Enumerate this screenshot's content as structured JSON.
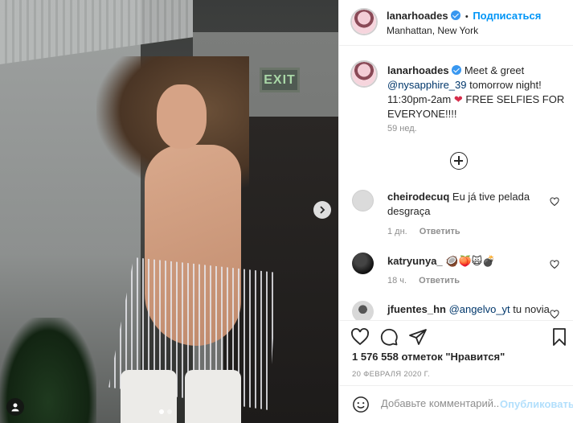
{
  "post": {
    "author": "lanarhoades",
    "follow_label": "Подписаться",
    "separator": "•",
    "location": "Manhattan, New York",
    "exit_sign_text": "EXIT"
  },
  "caption": {
    "author": "lanarhoades",
    "text_before": "Meet & greet",
    "mention": "@nysapphire_39",
    "text_after": "tomorrow night! 11:30pm-2am",
    "text_end": "FREE SELFIES FOR EVERYONE!!!!",
    "time": "59 нед."
  },
  "comments": [
    {
      "user": "cheirodecuq",
      "text": "Eu já tive pelada desgraça",
      "time": "1 дн.",
      "reply_label": "Ответить"
    },
    {
      "user": "katryunya_",
      "text": "🥥🍑🙀💣",
      "time": "18 ч.",
      "reply_label": "Ответить"
    },
    {
      "user": "jfuentes_hn",
      "mention": "@angelvo_yt",
      "text": "tu novia"
    }
  ],
  "likes_text": "1 576 558 отметок \"Нравится\"",
  "date_text": "20 ФЕВРАЛЯ 2020 Г.",
  "add_comment": {
    "placeholder": "Добавьте комментарий...",
    "publish_label": "Опубликовать"
  },
  "carousel": {
    "slides": 2,
    "active": 1
  },
  "colors": {
    "accent": "#0095f6",
    "verified": "#3897f0",
    "heart": "#ed4956"
  }
}
